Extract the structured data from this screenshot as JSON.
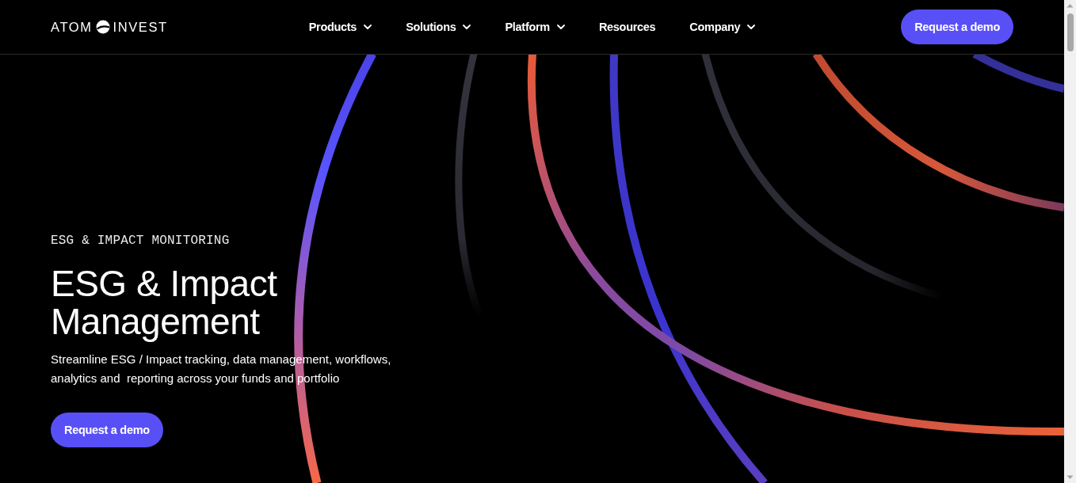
{
  "brand": {
    "word_1": "ATOM",
    "word_2": "INVEST"
  },
  "nav": {
    "items": [
      {
        "label": "Products",
        "has_menu": true
      },
      {
        "label": "Solutions",
        "has_menu": true
      },
      {
        "label": "Platform",
        "has_menu": true
      },
      {
        "label": "Resources",
        "has_menu": false
      },
      {
        "label": "Company",
        "has_menu": true
      }
    ],
    "cta": "Request a demo"
  },
  "hero": {
    "eyebrow": "ESG & IMPACT MONITORING",
    "title": "ESG & Impact Management",
    "description": "Streamline ESG / Impact tracking, data management, workflows, analytics and  reporting across your funds and portfolio",
    "button": "Request a demo"
  }
}
